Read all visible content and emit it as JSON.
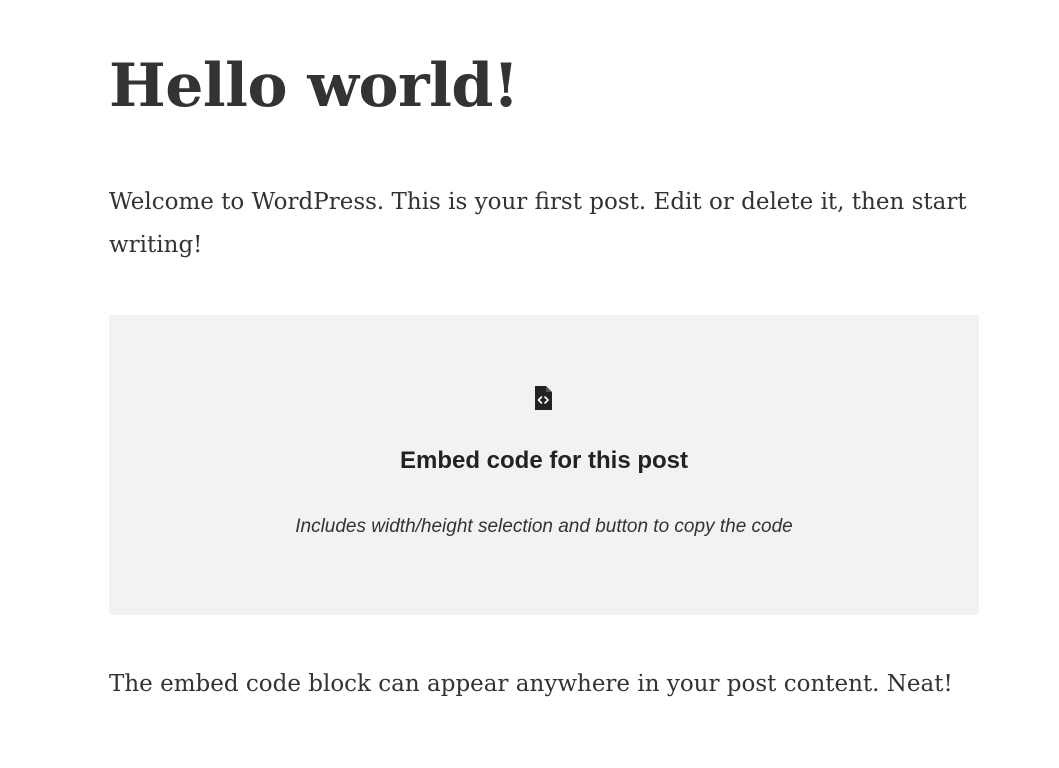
{
  "post": {
    "title": "Hello world!",
    "intro": "Welcome to WordPress. This is your first post. Edit or delete it, then start writing!",
    "outro": "The embed code block can appear anywhere in your post content. Neat!"
  },
  "embed_block": {
    "icon": "file-code-icon",
    "heading": "Embed code for this post",
    "description": "Includes width/height selection and button to copy the code",
    "background": "#f2f2f2"
  },
  "colors": {
    "text": "#333333",
    "heading": "#222222"
  }
}
